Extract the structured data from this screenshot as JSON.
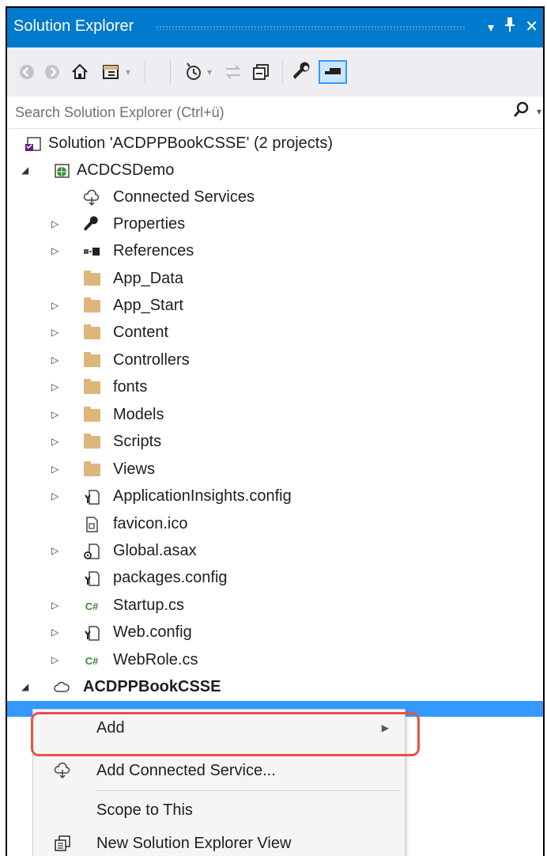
{
  "window": {
    "title": "Solution Explorer",
    "buttons": {
      "dropdown": "▾",
      "pin": "⊥",
      "close": "✕"
    }
  },
  "toolbar": {
    "icons": [
      "back-icon",
      "forward-icon",
      "home-icon",
      "switch-views-icon",
      "pending-changes-icon",
      "sync-icon",
      "collapse-all-icon",
      "properties-icon",
      "preview-icon"
    ]
  },
  "search": {
    "placeholder": "Search Solution Explorer (Ctrl+ü)"
  },
  "tree": {
    "solution": "Solution 'ACDPPBookCSSE' (2 projects)",
    "project1": "ACDCSDemo",
    "items": [
      "Connected Services",
      "Properties",
      "References",
      "App_Data",
      "App_Start",
      "Content",
      "Controllers",
      "fonts",
      "Models",
      "Scripts",
      "Views",
      "ApplicationInsights.config",
      "favicon.ico",
      "Global.asax",
      "packages.config",
      "Startup.cs",
      "Web.config",
      "WebRole.cs"
    ],
    "project2": "ACDPPBookCSSE"
  },
  "context_menu": {
    "items": [
      {
        "label": "Add",
        "has_submenu": true
      },
      {
        "label": "Add Connected Service..."
      },
      {
        "label": "Scope to This"
      },
      {
        "label": "New Solution Explorer View"
      }
    ]
  },
  "colors": {
    "titlebar": "#007acc",
    "selection": "#3399ff",
    "highlight": "#e8514a",
    "folder": "#dcb67a"
  }
}
